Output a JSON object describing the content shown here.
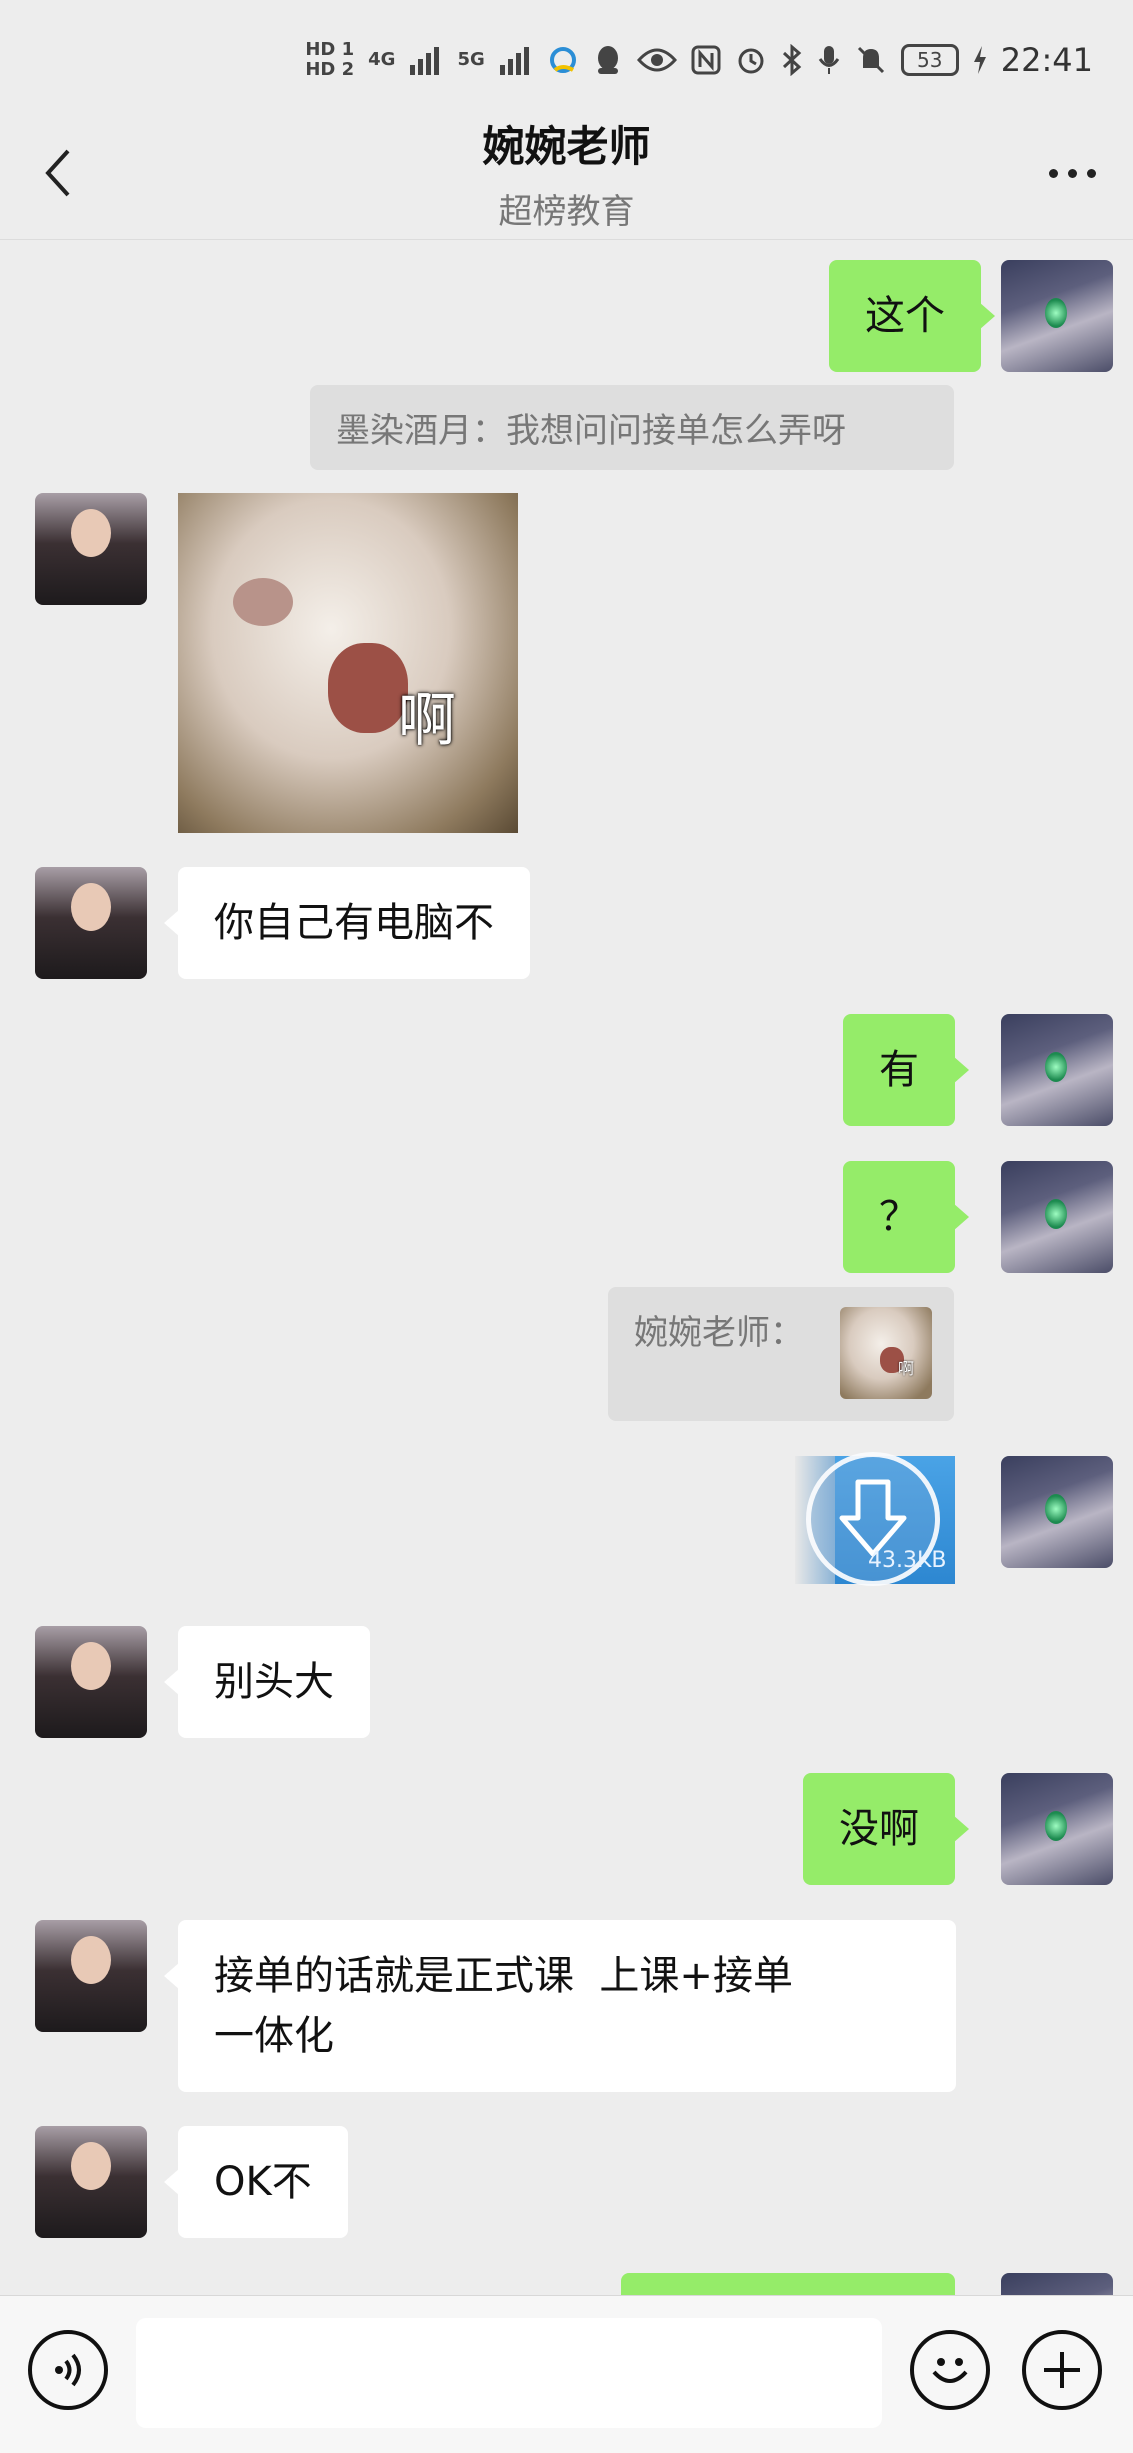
{
  "status_bar": {
    "sim1": "HD 1",
    "sim2": "HD 2",
    "net1": "4G",
    "net2": "5G",
    "battery": "53",
    "time": "22:41"
  },
  "header": {
    "title": "婉婉老师",
    "subtitle": "超榜教育",
    "back_icon": "chevron-left-icon",
    "more_icon": "more-dots-icon"
  },
  "messages": [
    {
      "from": "me",
      "type": "text",
      "text": "这个"
    },
    {
      "from": "system",
      "type": "quote",
      "text": "墨染酒月：我想问问接单怎么弄呀"
    },
    {
      "from": "them",
      "type": "sticker",
      "caption": "啊"
    },
    {
      "from": "them",
      "type": "text",
      "text": "你自己有电脑不"
    },
    {
      "from": "me",
      "type": "text",
      "text": "有"
    },
    {
      "from": "me",
      "type": "text",
      "text": "？"
    },
    {
      "from": "system",
      "type": "quote",
      "text": "婉婉老师：",
      "thumb_caption": "啊"
    },
    {
      "from": "me",
      "type": "file",
      "size": "43.3KB"
    },
    {
      "from": "them",
      "type": "text",
      "text": "别头大"
    },
    {
      "from": "me",
      "type": "text",
      "text": "没啊"
    },
    {
      "from": "them",
      "type": "text",
      "text_line1": "接单的话就是正式课  上课+接单",
      "text_line2": "一体化"
    },
    {
      "from": "them",
      "type": "text",
      "text": "OK不"
    }
  ],
  "input_bar": {
    "placeholder": "",
    "voice_icon": "voice-icon",
    "emoji_icon": "emoji-icon",
    "plus_icon": "plus-icon"
  },
  "colors": {
    "my_bubble": "#95ec69",
    "their_bubble": "#ffffff",
    "background": "#ededed"
  }
}
